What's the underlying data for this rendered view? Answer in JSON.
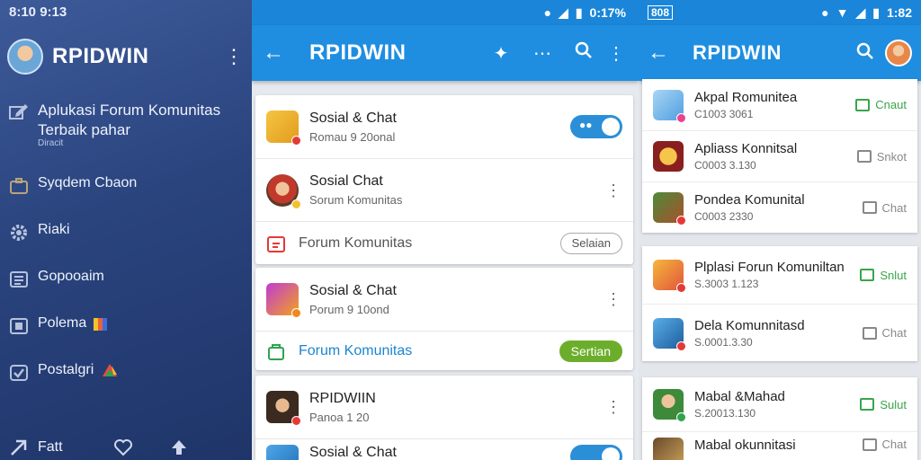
{
  "drawer": {
    "status_time": "8:10 9:13",
    "title": "RPIDWIN",
    "items": [
      {
        "label": "Aplukasi Forum Komunitas Terbaik pahar",
        "sub": "Diracit",
        "icon": "edit-icon"
      },
      {
        "label": "Syqdem Cbaon",
        "icon": "briefcase-icon"
      },
      {
        "label": "Riaki",
        "icon": "gear-icon"
      },
      {
        "label": "Gopooaim",
        "icon": "list-icon"
      },
      {
        "label": "Polema",
        "icon": "image-icon"
      },
      {
        "label": "Postalgri",
        "icon": "check-icon"
      },
      {
        "label": "Fatt",
        "icon": "arrow-icon"
      }
    ]
  },
  "middle": {
    "status_time": "0:17%",
    "title": "RPIDWIN",
    "cards": [
      {
        "rows": [
          {
            "title": "Sosial & Chat",
            "sub": "Romau 9 20onal",
            "control": "toggle"
          },
          {
            "title": "Sosial Chat",
            "sub": "Sorum Komunitas",
            "control": "menu"
          },
          {
            "link": "Forum Komunitas",
            "button": "Selaian"
          }
        ]
      },
      {
        "rows": [
          {
            "title": "Sosial & Chat",
            "sub": "Porum 9 10ond",
            "control": "menu"
          },
          {
            "link": "Forum Komunitas",
            "button": "Sertian"
          }
        ]
      },
      {
        "rows": [
          {
            "title": "RPIDWIIN",
            "sub": "Panoa 1 20",
            "control": "menu"
          },
          {
            "title": "Sosial & Chat",
            "sub": "",
            "control": "toggle"
          }
        ]
      }
    ]
  },
  "right": {
    "status_left": "808",
    "status_time": "1:82",
    "title": "RPIDWIN",
    "cards": [
      {
        "rows": [
          {
            "title": "Akpal Romunitea",
            "sub": "C1003 3061",
            "action": "Cnaut"
          },
          {
            "title": "Apliass Konnitsal",
            "sub": "C0003 3.130",
            "action": "Snkot"
          },
          {
            "title": "Pondea Komunital",
            "sub": "C0003 2330",
            "action": "Chat"
          }
        ]
      },
      {
        "rows": [
          {
            "title": "Plplasi Forun Komuniltan",
            "sub": "S.3003 1.123",
            "action": "Snlut"
          },
          {
            "title": "Dela Komunnitasd",
            "sub": "S.0001.3.30",
            "action": "Chat"
          }
        ]
      },
      {
        "rows": [
          {
            "title": "Mabal &Mahad",
            "sub": "S.20013.130",
            "action": "Sulut"
          },
          {
            "title": "Mabal okunnitasi",
            "sub": "",
            "action": "Chat"
          }
        ]
      }
    ]
  },
  "colors": {
    "primary": "#1f8ee0",
    "drawer": "#2a447e",
    "green": "#6cae2b",
    "danger": "#e53935"
  }
}
